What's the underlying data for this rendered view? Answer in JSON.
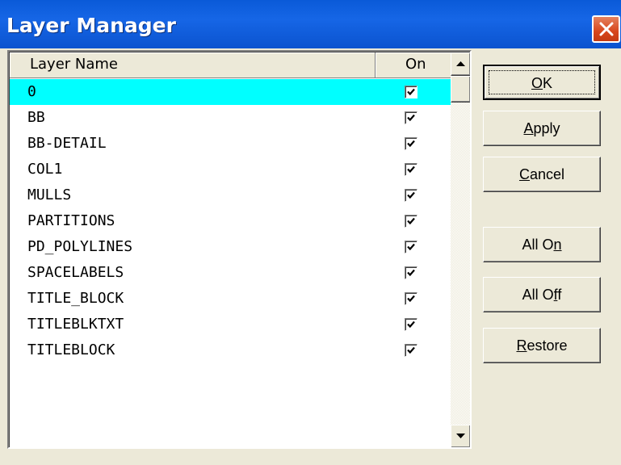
{
  "window": {
    "title": "Layer Manager"
  },
  "list": {
    "columns": [
      {
        "label": "Layer Name"
      },
      {
        "label": "On"
      }
    ],
    "layers": [
      {
        "name": "0",
        "on": true,
        "selected": true
      },
      {
        "name": "BB",
        "on": true,
        "selected": false
      },
      {
        "name": "BB-DETAIL",
        "on": true,
        "selected": false
      },
      {
        "name": "COL1",
        "on": true,
        "selected": false
      },
      {
        "name": "MULLS",
        "on": true,
        "selected": false
      },
      {
        "name": "PARTITIONS",
        "on": true,
        "selected": false
      },
      {
        "name": "PD_POLYLINES",
        "on": true,
        "selected": false
      },
      {
        "name": "SPACELABELS",
        "on": true,
        "selected": false
      },
      {
        "name": "TITLE_BLOCK",
        "on": true,
        "selected": false
      },
      {
        "name": "TITLEBLKTXT",
        "on": true,
        "selected": false
      },
      {
        "name": "TITLEBLOCK",
        "on": true,
        "selected": false
      }
    ]
  },
  "buttons": {
    "ok": {
      "pre": "",
      "key": "O",
      "post": "K"
    },
    "apply": {
      "pre": "",
      "key": "A",
      "post": "pply"
    },
    "cancel": {
      "pre": "",
      "key": "C",
      "post": "ancel"
    },
    "all_on": {
      "pre": "All O",
      "key": "n",
      "post": ""
    },
    "all_off": {
      "pre": "All O",
      "key": "f",
      "post": "f"
    },
    "restore": {
      "pre": "",
      "key": "R",
      "post": "estore"
    }
  },
  "colors": {
    "selection": "#00ffff",
    "titlebar": "#0a5ad8",
    "face": "#ece9d8"
  }
}
